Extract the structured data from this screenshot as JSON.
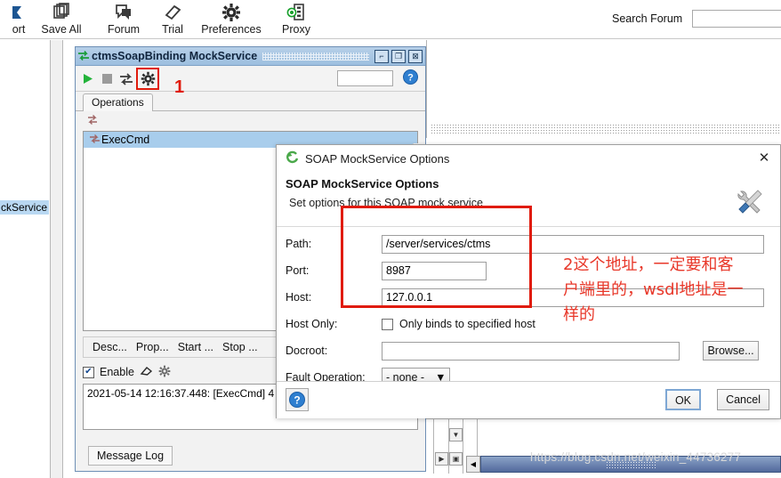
{
  "toolbar": {
    "items": [
      {
        "label": "ort",
        "icon": "export-icon"
      },
      {
        "label": "Save All",
        "icon": "save-all-icon"
      },
      {
        "label": "Forum",
        "icon": "forum-icon"
      },
      {
        "label": "Trial",
        "icon": "trial-icon"
      },
      {
        "label": "Preferences",
        "icon": "preferences-gear-icon"
      },
      {
        "label": "Proxy",
        "icon": "proxy-icon"
      }
    ],
    "search_label": "Search Forum",
    "search_value": "",
    "search_placeholder": ""
  },
  "sidebar": {
    "selected_node": "ckService"
  },
  "mdi_window": {
    "title": "ctmsSoapBinding MockService",
    "title_icon": "mock-service-icon",
    "buttons": {
      "minimize": "⌐",
      "maximize": "❐",
      "close": "⊠"
    },
    "toolbar": {
      "run_icon": "play-icon",
      "stop_icon": "stop-icon",
      "swap_icon": "swap-arrows-icon",
      "options_icon": "gear-icon",
      "field_value": "",
      "help_icon": "help-icon"
    },
    "annotation_step": "1",
    "tab": "Operations",
    "refresh_icon": "refresh-icon",
    "operations": [
      {
        "name": "ExecCmd",
        "icon": "operation-icon"
      }
    ],
    "action_buttons": [
      "Desc...",
      "Prop...",
      "Start ...",
      "Stop ..."
    ],
    "enable": {
      "checked": true,
      "label": "Enable",
      "clear_icon": "eraser-icon",
      "settings_icon": "gear-icon"
    },
    "log_entry": "2021-05-14 12:16:37.448: [ExecCmd] 4",
    "log_tab": "Message Log"
  },
  "dialog": {
    "titlebar_text": "SOAP MockService Options",
    "titlebar_icon": "soapui-icon",
    "close_icon": "close-icon",
    "heading": "SOAP MockService Options",
    "subheading": "Set options for this SOAP mock service",
    "heading_icon": "tools-icon",
    "fields": {
      "path_label": "Path:",
      "path_value": "/server/services/ctms",
      "port_label": "Port:",
      "port_value": "8987",
      "host_label": "Host:",
      "host_value": "127.0.0.1",
      "host_only_label": "Host Only:",
      "host_only_checkbox_label": "Only binds to specified host",
      "host_only_checked": false,
      "docroot_label": "Docroot:",
      "docroot_value": "",
      "browse_label": "Browse...",
      "fault_operation_label": "Fault Operation:",
      "fault_operation_value": "- none -",
      "fault_operation_options": [
        "- none -"
      ]
    },
    "footer": {
      "help_icon": "help-icon",
      "ok_label": "OK",
      "cancel_label": "Cancel"
    }
  },
  "annotations": {
    "red_note": "2这个地址，一定要和客\n户端里的，wsdl地址是一\n样的",
    "accent_color": "#e01b0c"
  },
  "watermark": "https://blog.csdn.net/weixin_44736277"
}
